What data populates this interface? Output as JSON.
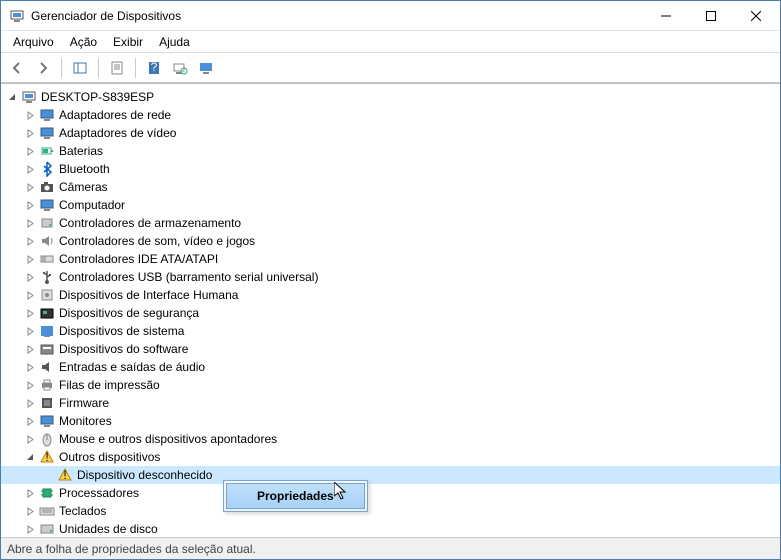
{
  "window": {
    "title": "Gerenciador de Dispositivos"
  },
  "menubar": {
    "arquivo": "Arquivo",
    "acao": "Ação",
    "exibir": "Exibir",
    "ajuda": "Ajuda"
  },
  "root": {
    "label": "DESKTOP-S839ESP"
  },
  "categories": [
    {
      "label": "Adaptadores de rede",
      "icon": "monitor"
    },
    {
      "label": "Adaptadores de vídeo",
      "icon": "monitor"
    },
    {
      "label": "Baterias",
      "icon": "battery"
    },
    {
      "label": "Bluetooth",
      "icon": "bluetooth"
    },
    {
      "label": "Câmeras",
      "icon": "camera"
    },
    {
      "label": "Computador",
      "icon": "monitor"
    },
    {
      "label": "Controladores de armazenamento",
      "icon": "storage"
    },
    {
      "label": "Controladores de som, vídeo e jogos",
      "icon": "sound"
    },
    {
      "label": "Controladores IDE ATA/ATAPI",
      "icon": "ide"
    },
    {
      "label": "Controladores USB (barramento serial universal)",
      "icon": "usb"
    },
    {
      "label": "Dispositivos de Interface Humana",
      "icon": "hid"
    },
    {
      "label": "Dispositivos de segurança",
      "icon": "security"
    },
    {
      "label": "Dispositivos de sistema",
      "icon": "system"
    },
    {
      "label": "Dispositivos do software",
      "icon": "software"
    },
    {
      "label": "Entradas e saídas de áudio",
      "icon": "audio-io"
    },
    {
      "label": "Filas de impressão",
      "icon": "printer"
    },
    {
      "label": "Firmware",
      "icon": "firmware"
    },
    {
      "label": "Monitores",
      "icon": "monitor"
    },
    {
      "label": "Mouse e outros dispositivos apontadores",
      "icon": "mouse"
    },
    {
      "label": "Outros dispositivos",
      "icon": "warning",
      "expanded": true,
      "children": [
        {
          "label": "Dispositivo desconhecido",
          "icon": "unknown",
          "selected": true
        }
      ]
    },
    {
      "label": "Processadores",
      "icon": "cpu"
    },
    {
      "label": "Teclados",
      "icon": "keyboard"
    },
    {
      "label": "Unidades de disco",
      "icon": "disk"
    }
  ],
  "context_menu": {
    "propriedades": "Propriedades"
  },
  "statusbar": {
    "text": "Abre a folha de propriedades da seleção atual."
  }
}
